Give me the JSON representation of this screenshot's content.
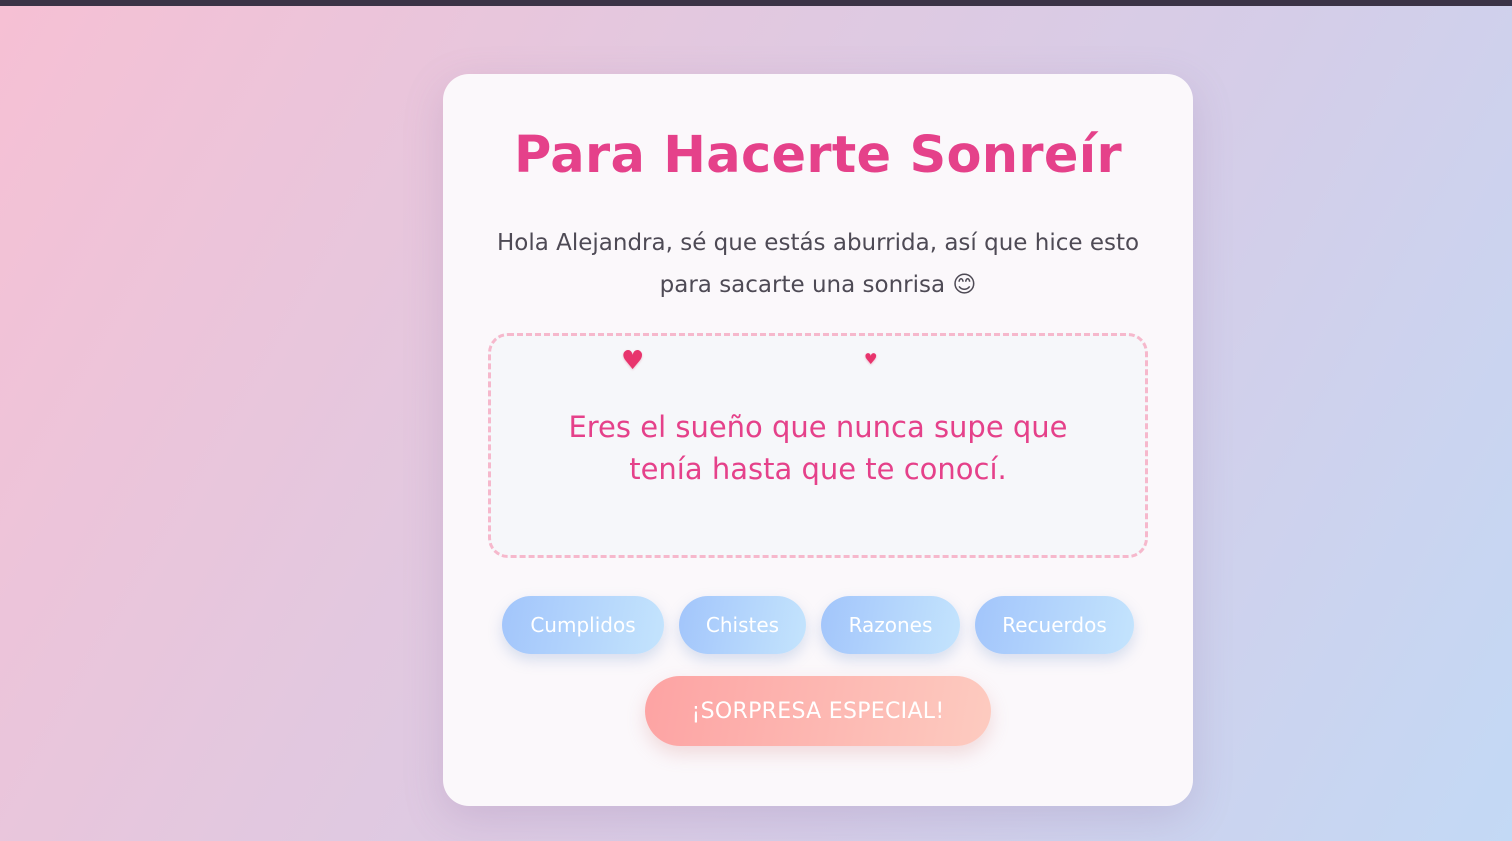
{
  "card": {
    "title": "Para Hacerte Sonreír",
    "intro": "Hola Alejandra, sé que estás aburrida, así que hice esto para sacarte una sonrisa 😊"
  },
  "message_box": {
    "text": "Eres el sueño que nunca supe que tenía hasta que te conocí.",
    "decorations": [
      {
        "icon": "heart-icon",
        "glyph": "♥",
        "color": "#e8346d"
      },
      {
        "icon": "heart-icon",
        "glyph": "♥",
        "color": "#e8346d"
      }
    ]
  },
  "categories": {
    "buttons": [
      {
        "label": "Cumplidos"
      },
      {
        "label": "Chistes"
      },
      {
        "label": "Razones"
      },
      {
        "label": "Recuerdos"
      }
    ]
  },
  "surprise_button": {
    "label": "¡SORPRESA ESPECIAL!"
  },
  "colors": {
    "accent": "#e5418a",
    "category_button": "#a2c5fb",
    "surprise_button": "#fda3a3",
    "dashed_border": "#f6b8cc"
  }
}
